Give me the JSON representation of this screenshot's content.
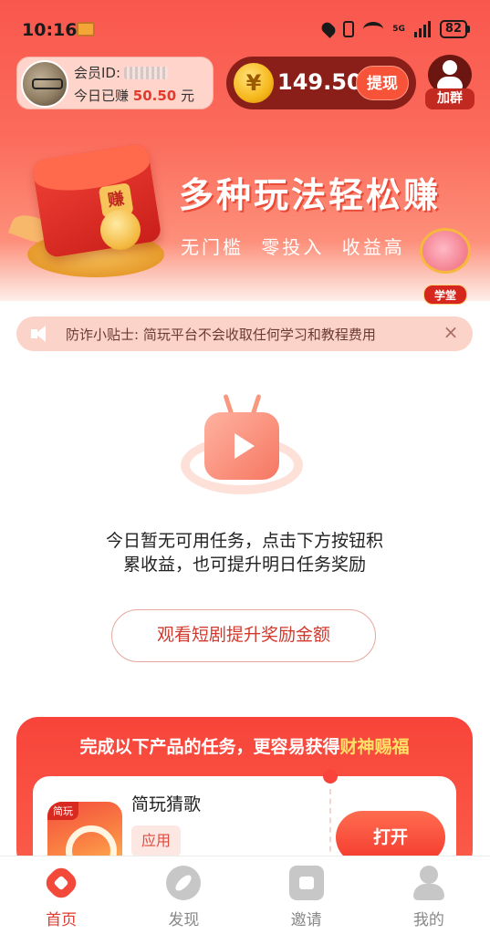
{
  "status_bar": {
    "time": "10:16",
    "network": "5G",
    "battery": "82"
  },
  "member": {
    "id_label": "会员ID:",
    "earned_prefix": "今日已赚",
    "earned_amount": "50.50",
    "earned_suffix": "元"
  },
  "balance": {
    "currency_symbol": "¥",
    "amount": "149.50",
    "withdraw_label": "提现"
  },
  "join_group": {
    "label": "加群",
    "icon": "user-add-icon"
  },
  "banner": {
    "title": "多种玩法轻松赚",
    "subtitle": "无门槛 零投入 收益高",
    "redpacket_text": "赚",
    "academy_label": "学堂"
  },
  "tip": {
    "text": "防诈小贴士: 简玩平台不会收取任何学习和教程费用",
    "close_icon": "×"
  },
  "empty_state": {
    "message": "今日暂无可用任务，点击下方按钮积累收益，也可提升明日任务奖励",
    "button_label": "观看短剧提升奖励金额"
  },
  "products": {
    "header_prefix": "完成以下产品的任务，更容易获得",
    "header_highlight": "财神赐福",
    "items": [
      {
        "icon_tag": "简玩",
        "name": "简玩猜歌",
        "tag": "应用",
        "button_label": "打开"
      }
    ]
  },
  "bottom_nav": {
    "items": [
      {
        "label": "首页",
        "icon": "home-icon",
        "active": true
      },
      {
        "label": "发现",
        "icon": "discover-icon",
        "active": false
      },
      {
        "label": "邀请",
        "icon": "invite-icon",
        "active": false
      },
      {
        "label": "我的",
        "icon": "profile-icon",
        "active": false
      }
    ]
  },
  "colors": {
    "brand_red": "#f2493b",
    "highlight_yellow": "#ffe066",
    "balance_pill": "#8a1f1a"
  }
}
